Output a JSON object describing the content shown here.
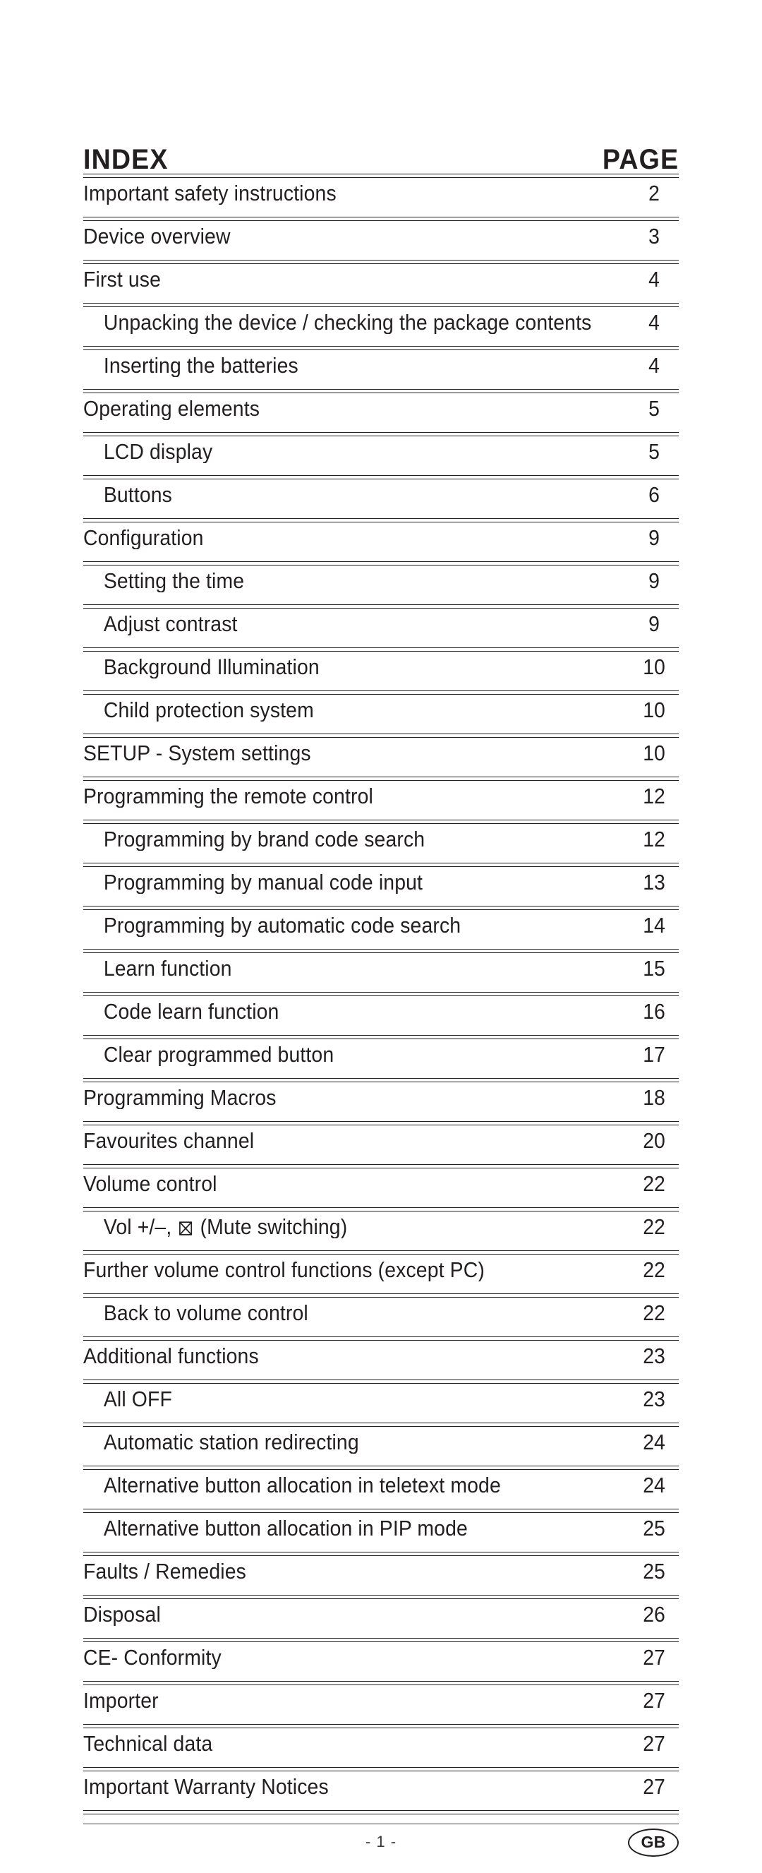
{
  "header": {
    "index_label": "INDEX",
    "page_label": "PAGE"
  },
  "toc": {
    "rows": [
      {
        "label": "Important safety instructions",
        "page": "2",
        "level": 1
      },
      {
        "label": "Device overview",
        "page": "3",
        "level": 1
      },
      {
        "label": "First use",
        "page": "4",
        "level": 1
      },
      {
        "label": "Unpacking the device / checking the package contents",
        "page": "4",
        "level": 2
      },
      {
        "label": "Inserting the batteries",
        "page": "4",
        "level": 2
      },
      {
        "label": "Operating elements",
        "page": "5",
        "level": 1
      },
      {
        "label": "LCD display",
        "page": "5",
        "level": 2
      },
      {
        "label": "Buttons",
        "page": "6",
        "level": 2
      },
      {
        "label": "Configuration",
        "page": "9",
        "level": 1
      },
      {
        "label": "Setting the time",
        "page": "9",
        "level": 2
      },
      {
        "label": "Adjust contrast",
        "page": "9",
        "level": 2
      },
      {
        "label": "Background Illumination",
        "page": "10",
        "level": 2
      },
      {
        "label": "Child protection system",
        "page": "10",
        "level": 2
      },
      {
        "label": "SETUP - System settings",
        "page": "10",
        "level": 1
      },
      {
        "label": "Programming the remote control",
        "page": "12",
        "level": 1
      },
      {
        "label": "Programming by brand code search",
        "page": "12",
        "level": 2
      },
      {
        "label": "Programming by manual code input",
        "page": "13",
        "level": 2
      },
      {
        "label": "Programming by automatic code search",
        "page": "14",
        "level": 2
      },
      {
        "label": "Learn function",
        "page": "15",
        "level": 2
      },
      {
        "label": "Code learn function",
        "page": "16",
        "level": 2
      },
      {
        "label": "Clear programmed button",
        "page": "17",
        "level": 2
      },
      {
        "label": "Programming Macros",
        "page": "18",
        "level": 1
      },
      {
        "label": "Favourites channel",
        "page": "20",
        "level": 1
      },
      {
        "label": "Volume control",
        "page": "22",
        "level": 1
      },
      {
        "label": "Vol +/–, ⌧ (Mute switching)",
        "page": "22",
        "level": 2,
        "icon": "mute-icon",
        "label_before": "Vol +/–, ",
        "label_after": " (Mute switching)"
      },
      {
        "label": "Further volume control functions (except PC)",
        "page": "22",
        "level": 1
      },
      {
        "label": "Back to volume control",
        "page": "22",
        "level": 2
      },
      {
        "label": "Additional functions",
        "page": "23",
        "level": 1
      },
      {
        "label": "All OFF",
        "page": "23",
        "level": 2
      },
      {
        "label": "Automatic station redirecting",
        "page": "24",
        "level": 2
      },
      {
        "label": "Alternative button allocation in teletext mode",
        "page": "24",
        "level": 2
      },
      {
        "label": "Alternative button allocation in PIP mode",
        "page": "25",
        "level": 2
      },
      {
        "label": "Faults / Remedies",
        "page": "25",
        "level": 1
      },
      {
        "label": "Disposal",
        "page": "26",
        "level": 1
      },
      {
        "label": "CE- Conformity",
        "page": "27",
        "level": 1
      },
      {
        "label": "Importer",
        "page": "27",
        "level": 1
      },
      {
        "label": "Technical data",
        "page": "27",
        "level": 1
      },
      {
        "label": "Important Warranty Notices",
        "page": "27",
        "level": 1
      }
    ]
  },
  "footer": {
    "page_number": "- 1 -",
    "language_code": "GB"
  },
  "colors": {
    "ink": "#231f20",
    "rule": "#231f20",
    "footer_rule": "#4a3f40",
    "background": "#ffffff"
  }
}
